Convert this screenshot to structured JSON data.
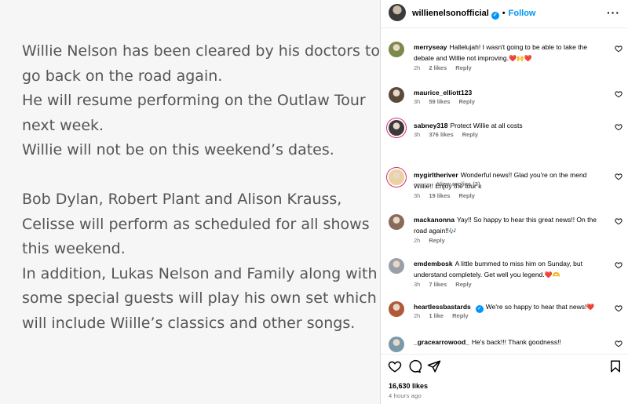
{
  "post_text": {
    "lines": [
      "Willie Nelson has been cleared by his doctors to",
      "go back on the road again.",
      "He will resume performing on the Outlaw Tour",
      "next week.",
      "Willie will not be on this weekend’s dates.",
      "",
      "Bob Dylan, Robert Plant and Alison Krauss,",
      "Celisse will perform as scheduled for all shows",
      "this weekend.",
      "In addition, Lukas Nelson and Family along with",
      "some special guests will play his own set which",
      "will include Wiille’s classics and other songs."
    ]
  },
  "header": {
    "username": "willienelsonofficial",
    "verified": "✓",
    "separator": "•",
    "follow": "Follow",
    "more": "···"
  },
  "comments": [
    {
      "user": "merryseay",
      "text": "Hallelujah! I wasn't going to be able to take the debate and Willie not improving.",
      "emoji": "❤️🙌❤️",
      "time": "2h",
      "likes": "2 likes",
      "reply": "Reply",
      "avatar_color": "#7a8a4a"
    },
    {
      "user": "maurice_elliott123",
      "text": "",
      "emoji": "",
      "time": "3h",
      "likes": "59 likes",
      "reply": "Reply",
      "avatar_color": "#5a4a3a"
    },
    {
      "user": "sabney318",
      "text": "Protect Willie at all costs",
      "emoji": "",
      "time": "3h",
      "likes": "376 likes",
      "reply": "Reply",
      "avatar_color": "#3a3a3a"
    },
    {
      "user": "mygirltheriver",
      "text": "Wonderful news!! Glad you're on the mend Willie!! Enjoy the tour x",
      "emoji": "",
      "time": "3h",
      "likes": "19 likes",
      "reply": "Reply",
      "avatar_color": "#e9d3a0"
    },
    {
      "user": "mackanonna",
      "text": "Yay!! So happy to hear this great news!! On the road again!!",
      "emoji": "🎶",
      "time": "2h",
      "likes": "",
      "reply": "Reply",
      "avatar_color": "#8a6a5a"
    },
    {
      "user": "emdembosk",
      "text": "A little bummed to miss him on Sunday, but understand completely. Get well you legend.",
      "emoji": "❤️🫶",
      "time": "3h",
      "likes": "7 likes",
      "reply": "Reply",
      "avatar_color": "#9aa0a8"
    },
    {
      "user": "heartlessbastards",
      "text": "We're so happy to hear that news!",
      "emoji": "❤️",
      "time": "2h",
      "likes": "1 like",
      "reply": "Reply",
      "avatar_color": "#b05a3a"
    },
    {
      "user": "_gracearrowood_",
      "text": "He's back!!! Thank goodness!!",
      "emoji": "",
      "time": "",
      "likes": "",
      "reply": "",
      "avatar_color": "#7a9aaa"
    }
  ],
  "view_replies": "View replies (3)",
  "likes_count": "16,630 likes",
  "time_ago": "4 hours ago",
  "icons": {
    "like": "heart-icon",
    "comment": "comment-icon",
    "share": "share-icon",
    "save": "bookmark-icon"
  }
}
